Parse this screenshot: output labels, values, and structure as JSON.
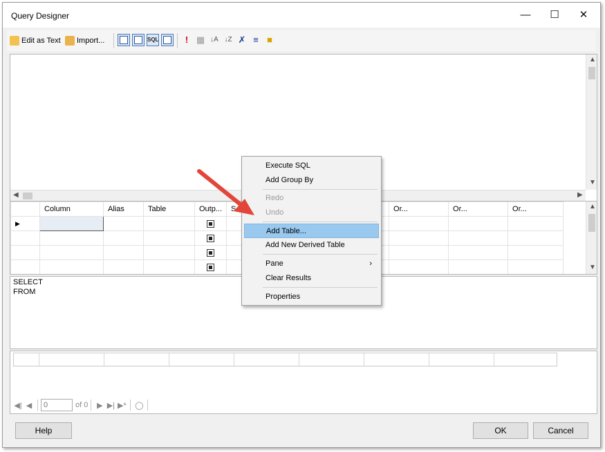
{
  "window": {
    "title": "Query Designer"
  },
  "toolbar": {
    "edit_as_text": "Edit as Text",
    "import": "Import...",
    "sql_btn": "SQL"
  },
  "grid": {
    "headers": [
      "Column",
      "Alias",
      "Table",
      "Outp...",
      "S",
      "Or...",
      "Or...",
      "Or..."
    ]
  },
  "sql": {
    "lines": [
      "SELECT",
      "FROM"
    ]
  },
  "nav": {
    "page_value": "0",
    "of_label": "of 0"
  },
  "buttons": {
    "help": "Help",
    "ok": "OK",
    "cancel": "Cancel"
  },
  "context_menu": {
    "items": [
      "Execute SQL",
      "Add Group By",
      "Redo",
      "Undo",
      "Add Table...",
      "Add New Derived Table",
      "Pane",
      "Clear Results",
      "Properties"
    ]
  },
  "colors": {
    "highlight": "#99c9ef",
    "arrow": "#e2463b",
    "toolbar_active": "#dbe7f7"
  }
}
